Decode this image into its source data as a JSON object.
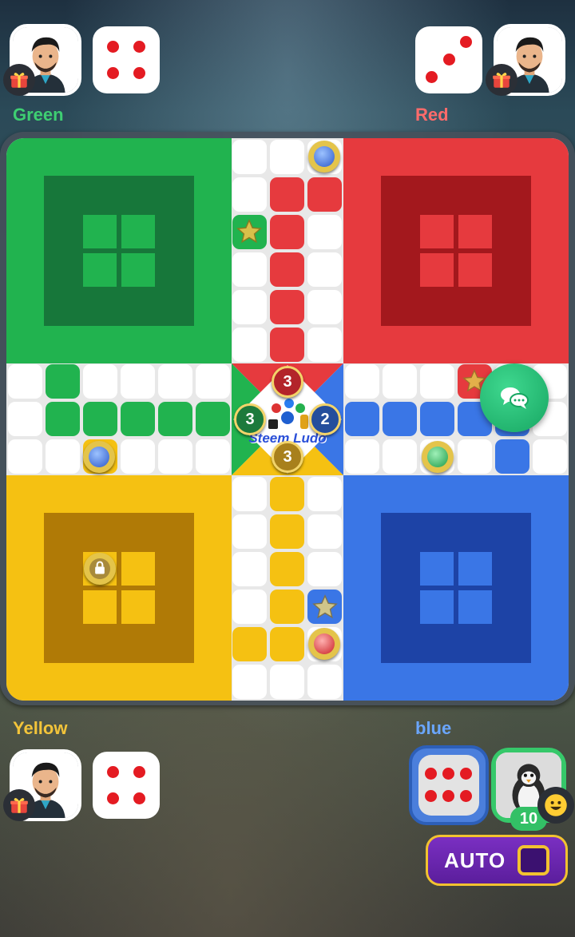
{
  "players": {
    "top_left": {
      "name": "Green",
      "color": "#3ecf72",
      "dice_value": 4
    },
    "top_right": {
      "name": "Red",
      "color": "#ff6b6b",
      "dice_value": 3
    },
    "bottom_left": {
      "name": "Yellow",
      "color": "#f3c43a",
      "dice_value": 4
    },
    "bottom_right": {
      "name": "blue",
      "color": "#6aa6ff",
      "dice_value": 6,
      "token_count": "10"
    }
  },
  "board": {
    "logo_text": "Steem Ludo",
    "center_counters": {
      "top": "3",
      "left": "3",
      "right": "2",
      "bottom": "3"
    }
  },
  "controls": {
    "auto_label": "AUTO"
  },
  "icons": {
    "gift": "gift-icon",
    "chat": "chat-icon",
    "emoji": "emoji-icon",
    "lock": "lock-icon",
    "star": "star-icon"
  },
  "colors": {
    "green": "#21b34f",
    "red": "#e63a3e",
    "yellow": "#f5c112",
    "blue": "#3a76e6"
  }
}
